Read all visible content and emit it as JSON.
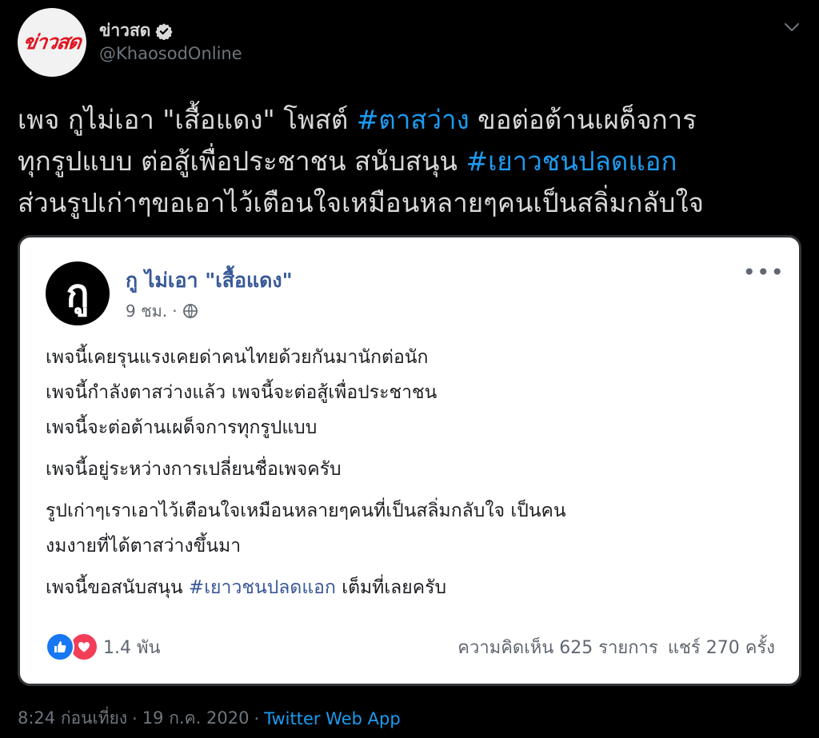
{
  "tweet": {
    "avatar_logo_text": "ข่าวสด",
    "display_name": "ข่าวสด",
    "handle": "@KhaosodOnline",
    "text_lines": [
      [
        {
          "text": "เพจ กูไม่เอา \"เสื้อแดง\" โพสต์ ",
          "hashtag": false
        },
        {
          "text": "#ตาสว่าง",
          "hashtag": true
        },
        {
          "text": " ขอต่อต้านเผด็จการ",
          "hashtag": false
        }
      ],
      [
        {
          "text": "ทุกรูปแบบ ต่อสู้เพื่อประชาชน สนับสนุน ",
          "hashtag": false
        },
        {
          "text": "#เยาวชนปลดแอก",
          "hashtag": true
        }
      ],
      [
        {
          "text": "ส่วนรูปเก่าๆขอเอาไว้เตือนใจเหมือนหลายๆคนเป็นสลิ่มกลับใจ",
          "hashtag": false
        }
      ]
    ],
    "time": "8:24 ก่อนเที่ยง",
    "date": "19 ก.ค. 2020",
    "separator": "·",
    "source": "Twitter Web App"
  },
  "fb_card": {
    "avatar_glyph": "กู",
    "page_name": "กู ไม่เอา \"เสื้อแดง\"",
    "time_ago": "9 ชม.",
    "dot": "·",
    "more": "•••",
    "body": [
      [
        [
          {
            "text": "เพจนี้เคยรุนแรงเคยด่าคนไทยด้วยกันมานักต่อนัก",
            "hashtag": false
          }
        ],
        [
          {
            "text": "เพจนี้กำลังตาสว่างแล้ว เพจนี้จะต่อสู้เพื่อประชาชน",
            "hashtag": false
          }
        ],
        [
          {
            "text": "เพจนี้จะต่อต้านเผด็จการทุกรูปแบบ",
            "hashtag": false
          }
        ]
      ],
      [
        [
          {
            "text": "เพจนี้อยู่ระหว่างการเปลี่ยนชื่อเพจครับ",
            "hashtag": false
          }
        ]
      ],
      [
        [
          {
            "text": "รูปเก่าๆเราเอาไว้เตือนใจเหมือนหลายๆคนที่เป็นสลิ่มกลับใจ เป็นคน",
            "hashtag": false
          }
        ],
        [
          {
            "text": "งมงายที่ได้ตาสว่างขึ้นมา",
            "hashtag": false
          }
        ]
      ],
      [
        [
          {
            "text": "เพจนี้ขอสนับสนุน ",
            "hashtag": false
          },
          {
            "text": "#เยาวชนปลดแอก",
            "hashtag": true
          },
          {
            "text": " เต็มที่เลยครับ",
            "hashtag": false
          }
        ]
      ]
    ],
    "reactions_count": "1.4 พัน",
    "comments": "ความคิดเห็น 625 รายการ",
    "shares": "แชร์ 270 ครั้ง"
  },
  "colors": {
    "background": "#000000",
    "text": "#d9d9d9",
    "hashtag": "#1d9bf0",
    "muted": "#6e767d",
    "card_bg": "#ffffff",
    "fb_link": "#385898",
    "brand_red": "#e0141e"
  },
  "icons": {
    "verified": "verified-badge-icon",
    "chevron": "chevron-down-icon",
    "globe": "globe-icon",
    "like": "like-reaction-icon",
    "love": "love-reaction-icon"
  }
}
